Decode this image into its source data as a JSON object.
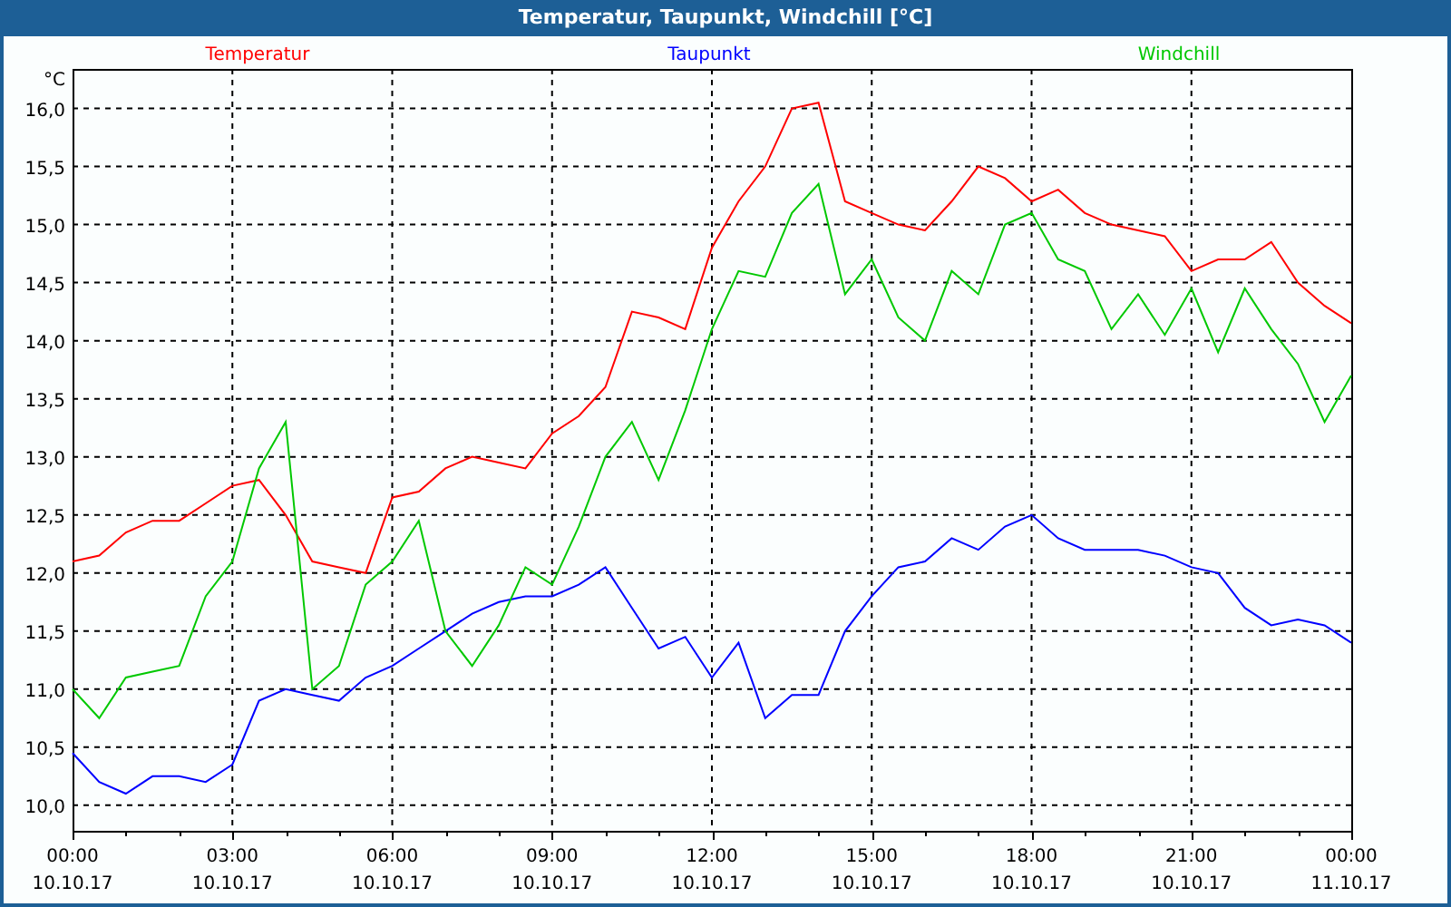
{
  "window": {
    "title": "Temperatur, Taupunkt, Windchill [°C]"
  },
  "chart": {
    "chart_data": {
      "type": "line",
      "ylabel": "°C",
      "categories": [
        "00:00 10.10.17",
        null,
        null,
        null,
        null,
        null,
        "03:00 10.10.17",
        null,
        null,
        null,
        null,
        null,
        "06:00 10.10.17",
        null,
        null,
        null,
        null,
        null,
        "09:00 10.10.17",
        null,
        null,
        null,
        null,
        null,
        "12:00 10.10.17",
        null,
        null,
        null,
        null,
        null,
        "15:00 10.10.17",
        null,
        null,
        null,
        null,
        null,
        "18:00 10.10.17",
        null,
        null,
        null,
        null,
        null,
        "21:00 10.10.17",
        null,
        null,
        null,
        null,
        null,
        "00:00 11.10.17"
      ],
      "series": [
        {
          "name": "Temperatur",
          "color": "#ff0000",
          "values": [
            12.1,
            12.15,
            12.35,
            12.45,
            12.45,
            12.6,
            12.75,
            12.8,
            12.5,
            12.1,
            12.05,
            12.0,
            12.65,
            12.7,
            12.9,
            13.0,
            12.95,
            12.9,
            13.2,
            13.35,
            13.6,
            14.25,
            14.2,
            14.1,
            14.8,
            15.2,
            15.5,
            16.0,
            16.05,
            15.2,
            15.1,
            15.0,
            14.95,
            15.2,
            15.5,
            15.4,
            15.2,
            15.3,
            15.1,
            15.0,
            14.95,
            14.9,
            14.6,
            14.7,
            14.7,
            14.85,
            14.5,
            14.3,
            14.15
          ]
        },
        {
          "name": "Taupunkt",
          "color": "#0000ff",
          "values": [
            10.45,
            10.2,
            10.1,
            10.25,
            10.25,
            10.2,
            10.35,
            10.9,
            11.0,
            10.95,
            10.9,
            11.1,
            11.2,
            11.35,
            11.5,
            11.65,
            11.75,
            11.8,
            11.8,
            11.9,
            12.05,
            11.7,
            11.35,
            11.45,
            11.1,
            11.4,
            10.75,
            10.95,
            10.95,
            11.5,
            11.8,
            12.05,
            12.1,
            12.3,
            12.2,
            12.4,
            12.5,
            12.3,
            12.2,
            12.2,
            12.2,
            12.15,
            12.05,
            12.0,
            11.7,
            11.55,
            11.6,
            11.55,
            11.4
          ]
        },
        {
          "name": "Windchill",
          "color": "#00c800",
          "values": [
            11.0,
            10.75,
            11.1,
            11.15,
            11.2,
            11.8,
            12.1,
            12.9,
            13.3,
            11.0,
            11.2,
            11.9,
            12.1,
            12.45,
            11.5,
            11.2,
            11.55,
            12.05,
            11.9,
            12.4,
            13.0,
            13.3,
            12.8,
            13.4,
            14.1,
            14.6,
            14.55,
            15.1,
            15.35,
            14.4,
            14.7,
            14.2,
            14.0,
            14.6,
            14.4,
            15.0,
            15.1,
            14.7,
            14.6,
            14.1,
            14.4,
            14.05,
            14.45,
            13.9,
            14.45,
            14.1,
            13.8,
            13.3,
            13.7
          ]
        }
      ],
      "grid": true,
      "ylim": [
        9.78,
        16.34
      ],
      "yticks": [
        {
          "value": 10,
          "label": "10,0"
        },
        {
          "value": 10.5,
          "label": "10,5"
        },
        {
          "value": 11,
          "label": "11,0"
        },
        {
          "value": 11.5,
          "label": "11,5"
        },
        {
          "value": 12,
          "label": "12,0"
        },
        {
          "value": 12.5,
          "label": "12,5"
        },
        {
          "value": 13,
          "label": "13,0"
        },
        {
          "value": 13.5,
          "label": "13,5"
        },
        {
          "value": 14,
          "label": "14,0"
        },
        {
          "value": 14.5,
          "label": "14,5"
        },
        {
          "value": 15,
          "label": "15,0"
        },
        {
          "value": 15.5,
          "label": "15,5"
        },
        {
          "value": 16,
          "label": "16,0"
        }
      ]
    }
  }
}
